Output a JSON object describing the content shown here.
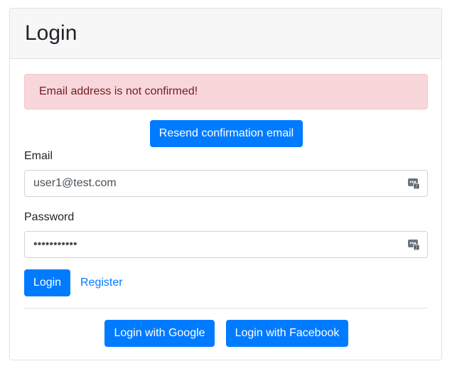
{
  "card": {
    "title": "Login"
  },
  "alert": {
    "message": "Email address is not confirmed!"
  },
  "resend": {
    "label": "Resend confirmation email"
  },
  "form": {
    "email_label": "Email",
    "email_value": "user1@test.com",
    "password_label": "Password",
    "password_value": "password123"
  },
  "actions": {
    "login_label": "Login",
    "register_label": "Register"
  },
  "external": {
    "google_label": "Login with Google",
    "facebook_label": "Login with Facebook"
  },
  "icons": {
    "password_manager": "password-manager-icon"
  },
  "colors": {
    "primary": "#007bff",
    "alert_bg": "#f8d7da",
    "alert_text": "#721c24",
    "header_bg": "#f7f7f7"
  }
}
